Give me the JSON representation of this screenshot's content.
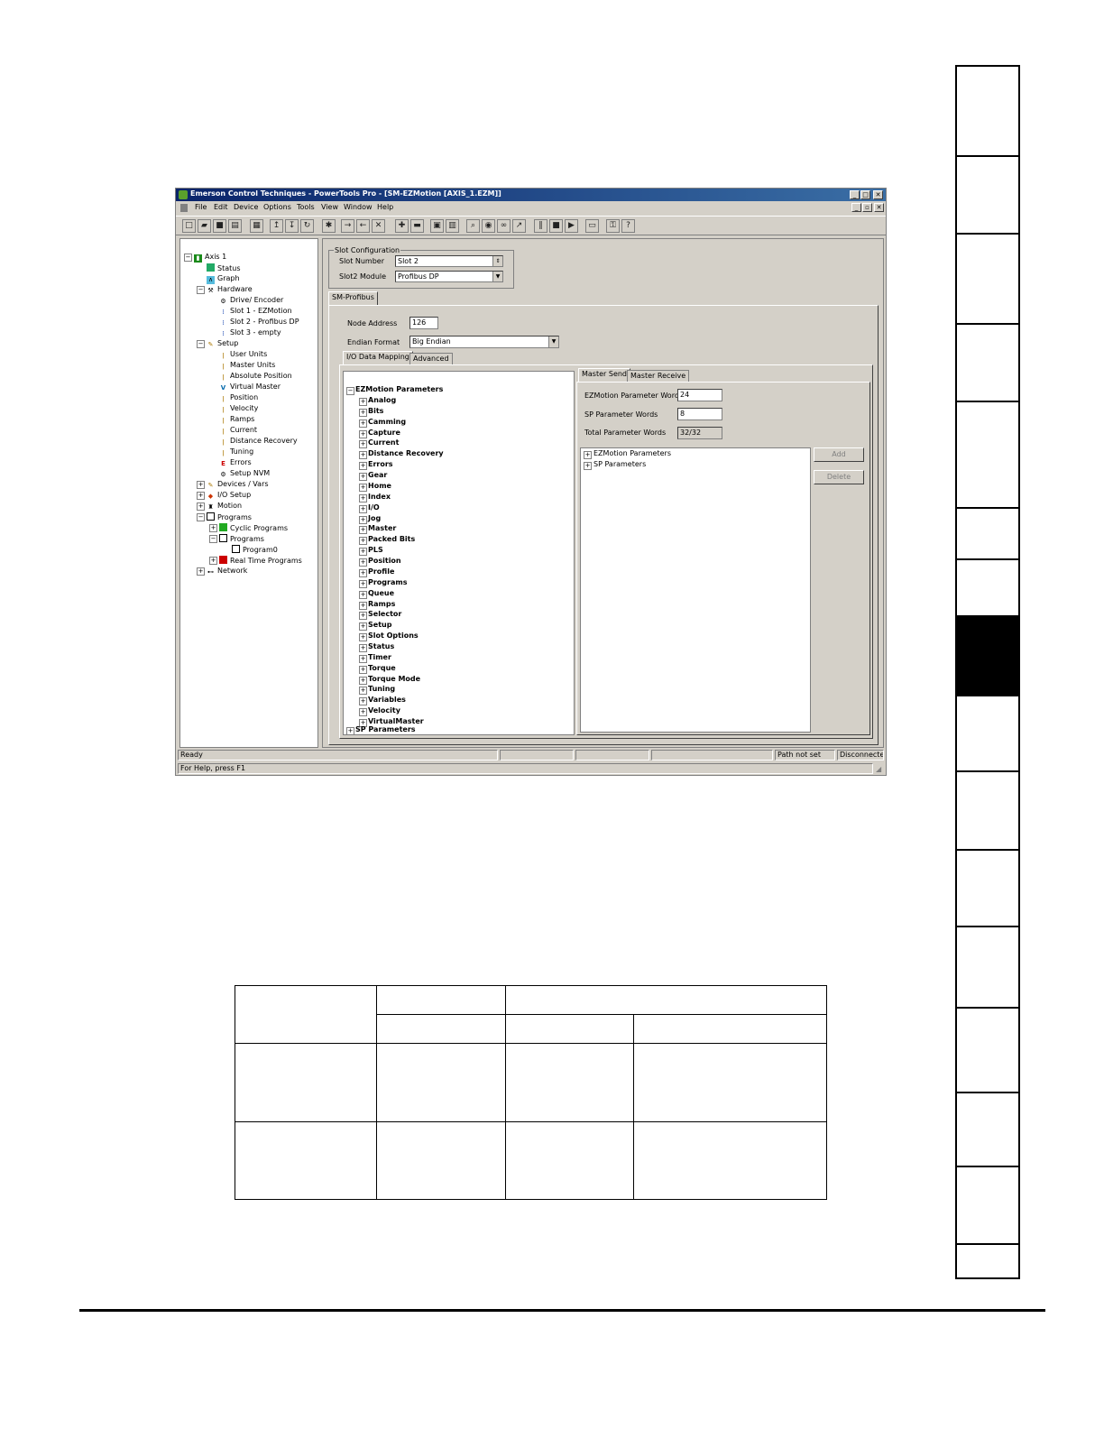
{
  "window": {
    "title": "Emerson Control Techniques - PowerTools Pro - [SM-EZMotion    [AXIS_1.EZM]]",
    "controls": [
      "_",
      "□",
      "✕"
    ],
    "mdi_controls": [
      "_",
      "▫",
      "✕"
    ]
  },
  "menu": [
    "File",
    "Edit",
    "Device",
    "Options",
    "Tools",
    "View",
    "Window",
    "Help"
  ],
  "tree": {
    "root": "Axis 1",
    "items": {
      "status": "Status",
      "graph": "Graph",
      "hardware": "Hardware",
      "drive_encoder": "Drive/ Encoder",
      "slot1": "Slot 1 - EZMotion",
      "slot2": "Slot 2 - Profibus DP",
      "slot3": "Slot 3 - empty",
      "setup": "Setup",
      "user_units": "User Units",
      "master_units": "Master Units",
      "absolute_position": "Absolute Position",
      "virtual_master": "Virtual Master",
      "position": "Position",
      "velocity": "Velocity",
      "ramps": "Ramps",
      "current": "Current",
      "distance_recovery": "Distance Recovery",
      "tuning": "Tuning",
      "errors": "Errors",
      "setup_nvm": "Setup NVM",
      "devices_vars": "Devices / Vars",
      "io_setup": "I/O Setup",
      "motion": "Motion",
      "programs": "Programs",
      "cyclic_programs": "Cyclic Programs",
      "programs_sub": "Programs",
      "program0": "Program0",
      "realtime_programs": "Real Time Programs",
      "network": "Network"
    }
  },
  "slot_config": {
    "group_label": "Slot Configuration",
    "slot_number_label": "Slot Number",
    "slot_number_value": "Slot 2",
    "slot_module_label": "Slot2 Module",
    "slot_module_value": "Profibus DP"
  },
  "module_tab": "SM-Profibus",
  "node_address_label": "Node Address",
  "node_address_value": "126",
  "endian_label": "Endian Format",
  "endian_value": "Big Endian",
  "sub_tabs": [
    "I/O Data Mapping",
    "Advanced"
  ],
  "parameters": {
    "root": "EZMotion Parameters",
    "items": [
      "Analog",
      "Bits",
      "Camming",
      "Capture",
      "Current",
      "Distance Recovery",
      "Errors",
      "Gear",
      "Home",
      "Index",
      "I/O",
      "Jog",
      "Master",
      "Packed Bits",
      "PLS",
      "Position",
      "Profile",
      "Programs",
      "Queue",
      "Ramps",
      "Selector",
      "Setup",
      "Slot Options",
      "Status",
      "Timer",
      "Torque",
      "Torque Mode",
      "Tuning",
      "Variables",
      "Velocity",
      "VirtualMaster"
    ],
    "sp_root": "SP Parameters"
  },
  "master_tabs": [
    "Master Send",
    "Master Receive"
  ],
  "words": {
    "ezm_label": "EZMotion Parameter Words",
    "ezm_value": "24",
    "sp_label": "SP Parameter Words",
    "sp_value": "8",
    "total_label": "Total Parameter Words",
    "total_value": "32/32"
  },
  "mapped_list": [
    "EZMotion Parameters",
    "SP Parameters"
  ],
  "buttons": {
    "add": "Add",
    "delete": "Delete"
  },
  "status": {
    "ready": "Ready",
    "path": "Path not set",
    "conn": "Disconnected",
    "help": "For Help, press F1"
  }
}
